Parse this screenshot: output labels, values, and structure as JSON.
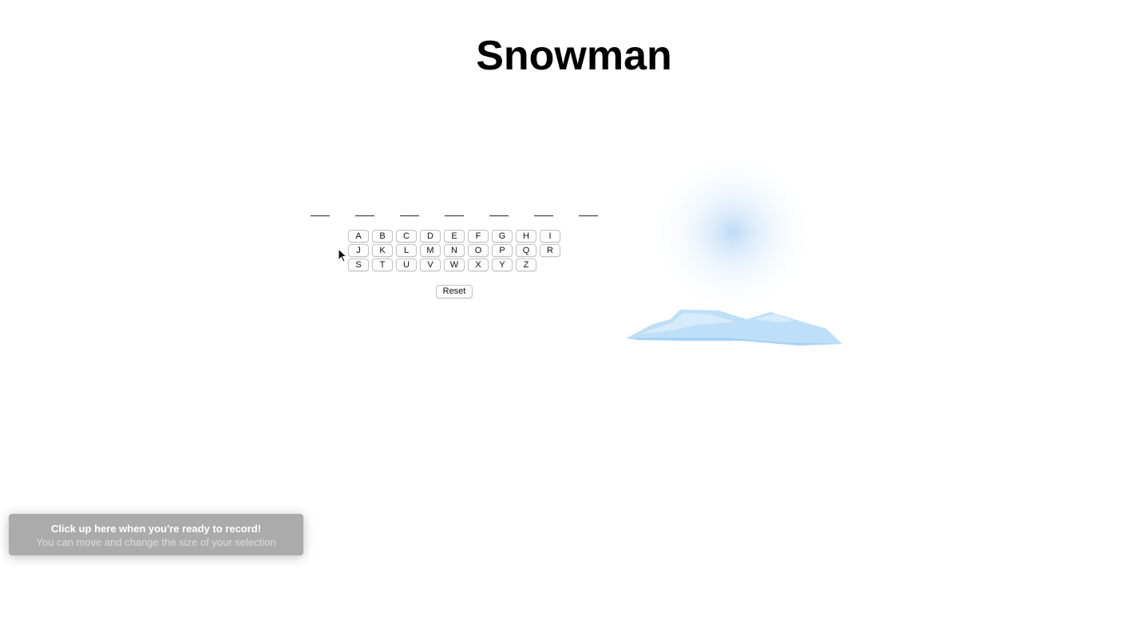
{
  "title": "Snowman",
  "word": {
    "slots": [
      "",
      "",
      "",
      "",
      "",
      "",
      ""
    ]
  },
  "keyboard": {
    "rows": [
      [
        "A",
        "B",
        "C",
        "D",
        "E",
        "F",
        "G",
        "H",
        "I"
      ],
      [
        "J",
        "K",
        "L",
        "M",
        "N",
        "O",
        "P",
        "Q",
        "R"
      ],
      [
        "S",
        "T",
        "U",
        "V",
        "W",
        "X",
        "Y",
        "Z"
      ]
    ]
  },
  "reset_label": "Reset",
  "record_banner": {
    "title": "Click up here when you're ready to record!",
    "subtitle": "You can move and change the size of your selection"
  },
  "colors": {
    "snow_glow": "#a9cff5",
    "ice_light": "#bfdff9",
    "ice_mid": "#a6d2f7",
    "banner_bg": "#ababab"
  },
  "icons": {
    "cursor": "arrow-cursor-icon",
    "snow_glow": "snow-glow",
    "ice_ground": "ice-patch"
  }
}
